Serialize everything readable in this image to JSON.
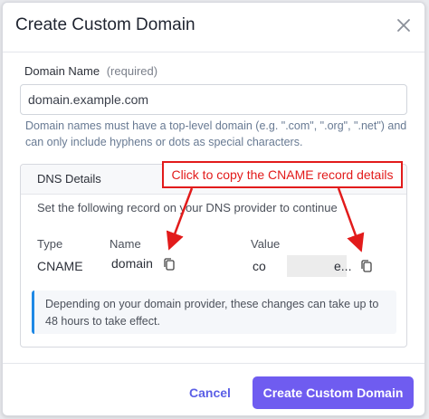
{
  "dialog": {
    "title": "Create Custom Domain",
    "close_icon": "close-icon"
  },
  "domain_name": {
    "label": "Domain Name",
    "required_hint": "(required)",
    "value": "domain.example.com",
    "help": "Domain names must have a top-level domain (e.g. \".com\", \".org\", \".net\") and can only include hyphens or dots as special characters."
  },
  "dns": {
    "title": "DNS Details",
    "description": "Set the following record on your DNS provider to continue",
    "columns": [
      "Type",
      "Name",
      "Value"
    ],
    "record": {
      "type": "CNAME",
      "name": "domain",
      "value_prefix": "co",
      "value_suffix": "e..."
    },
    "copy_icon": "copy-icon",
    "info": "Depending on your domain provider, these changes can take up to 48 hours to take effect."
  },
  "annotation": {
    "text": "Click to copy the CNAME record details",
    "color": "#e21b1b"
  },
  "footer": {
    "cancel_label": "Cancel",
    "create_label": "Create Custom Domain"
  },
  "colors": {
    "primary": "#6f5cf0",
    "link": "#5b5fe6",
    "info_border": "#1e88e5",
    "annotation": "#e21b1b"
  }
}
